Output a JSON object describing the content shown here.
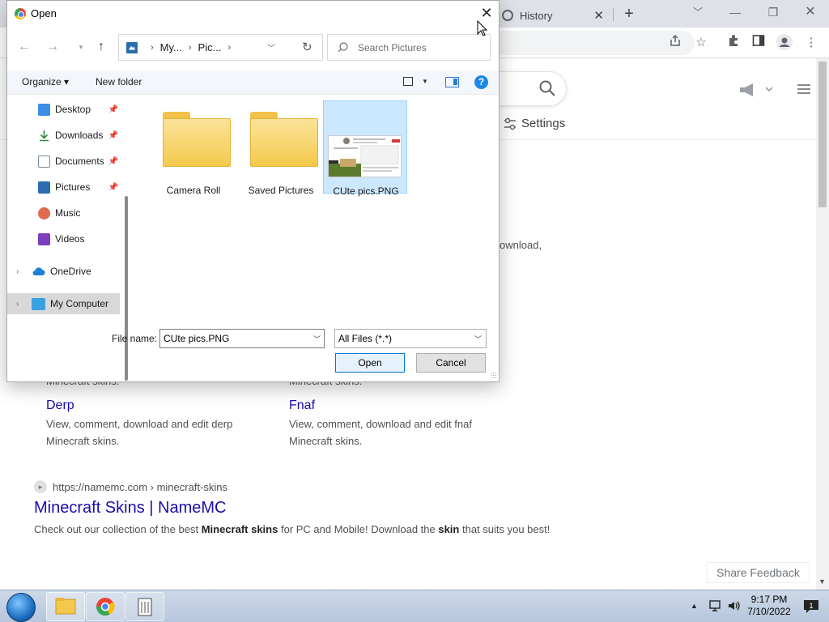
{
  "browser": {
    "tab_title": "History",
    "tab_close": "✕",
    "new_tab": "+",
    "minimize": "—",
    "maximize": "❐",
    "close": "✕"
  },
  "page": {
    "settings_label": "Settings",
    "download_fragment": "ownload,",
    "minecraft_skins_a": "Minecraft skins.",
    "minecraft_skins_b": "Minecraft skins.",
    "derp_link": "Derp",
    "derp_desc": "View, comment, download and edit derp Minecraft skins.",
    "fnaf_link": "Fnaf",
    "fnaf_desc": "View, comment, download and edit fnaf Minecraft skins.",
    "result_url": "https://namemc.com › minecraft-skins",
    "result_title": "Minecraft Skins | NameMC",
    "result_desc_1": "Check out our collection of the best ",
    "result_desc_b1": "Minecraft skins",
    "result_desc_2": " for PC and Mobile! Download the ",
    "result_desc_b2": "skin",
    "result_desc_3": " that suits you best!",
    "share_feedback": "Share Feedback"
  },
  "dialog": {
    "title": "Open",
    "close": "✕",
    "breadcrumb": [
      "My...",
      "Pic..."
    ],
    "search_placeholder": "Search Pictures",
    "organize": "Organize ▾",
    "new_folder": "New folder",
    "help": "?",
    "nav_items": [
      {
        "label": "Desktop"
      },
      {
        "label": "Downloads"
      },
      {
        "label": "Documents"
      },
      {
        "label": "Pictures"
      },
      {
        "label": "Music"
      },
      {
        "label": "Videos"
      },
      {
        "label": "OneDrive"
      },
      {
        "label": "My Computer"
      }
    ],
    "files": [
      {
        "name": "Camera Roll",
        "type": "folder"
      },
      {
        "name": "Saved Pictures",
        "type": "folder"
      },
      {
        "name": "CUte pics.PNG",
        "type": "image",
        "selected": true
      }
    ],
    "filename_label": "File name:",
    "filename_value": "CUte pics.PNG",
    "filetype_value": "All Files (*.*)",
    "open_label": "Open",
    "cancel_label": "Cancel"
  },
  "taskbar": {
    "time": "9:17 PM",
    "date": "7/10/2022",
    "notification_count": "1"
  },
  "colors": {
    "link": "#1a0dab",
    "selection": "#cce8ff",
    "folder": "#f4c94b",
    "taskbar": "#b6c6dc"
  }
}
